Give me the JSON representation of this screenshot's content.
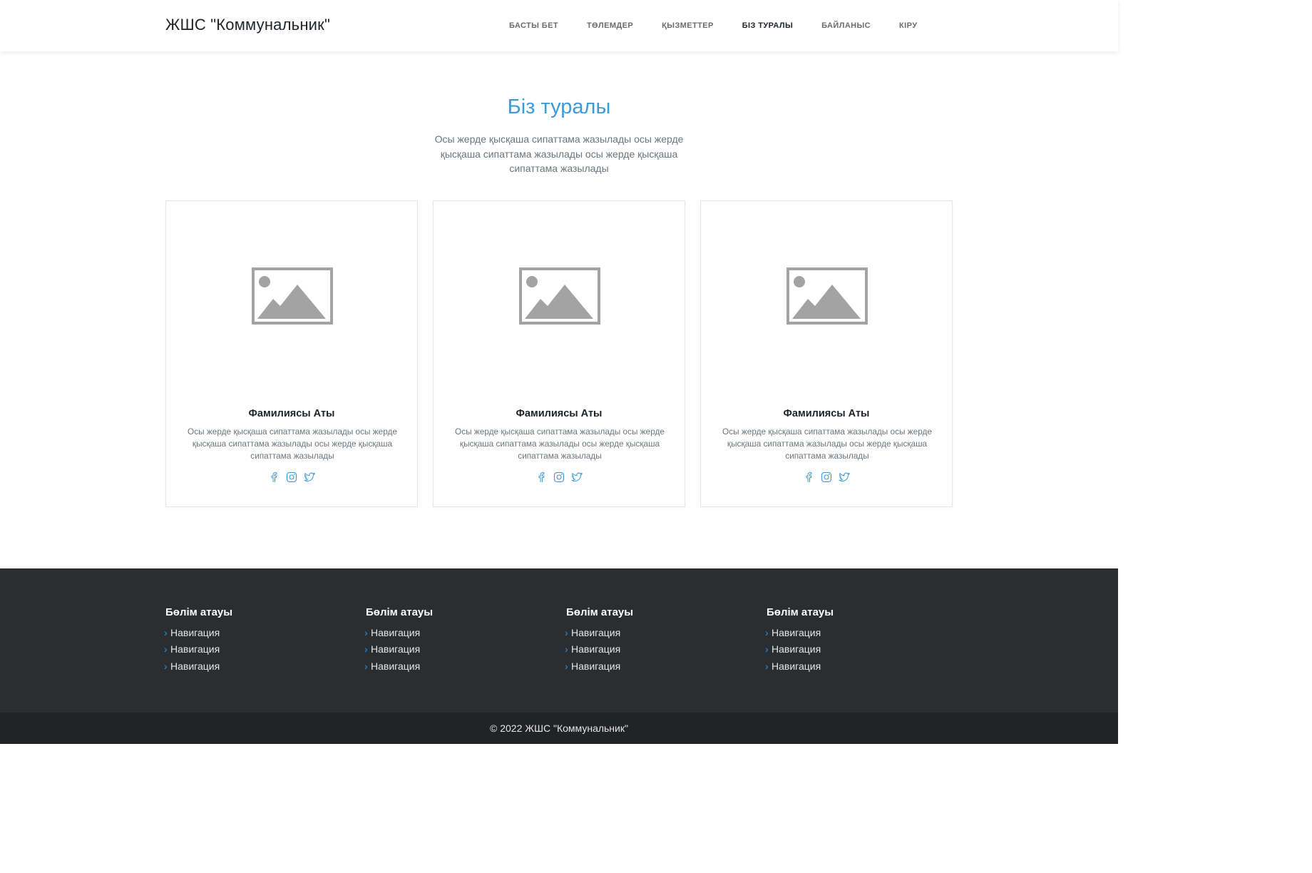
{
  "header": {
    "brand": "ЖШС \"Коммунальник\"",
    "nav": [
      "БАСТЫ БЕТ",
      "ТӨЛЕМДЕР",
      "ҚЫЗМЕТТЕР",
      "БІЗ ТУРАЛЫ",
      "БАЙЛАНЫС",
      "КІРУ"
    ],
    "active": "БІЗ ТУРАЛЫ"
  },
  "hero": {
    "title": "Біз туралы",
    "description": "Осы жерде қысқаша сипаттама жазылады осы жерде қысқаша сипаттама жазылады осы жерде қысқаша сипаттама жазылады"
  },
  "cards": [
    {
      "name": "Фамилиясы Аты",
      "description": "Осы жерде қысқаша сипаттама жазылады осы жерде қысқаша сипаттама жазылады осы жерде қысқаша сипаттама жазылады",
      "social": [
        "facebook-icon",
        "instagram-icon",
        "twitter-icon"
      ]
    },
    {
      "name": "Фамилиясы Аты",
      "description": "Осы жерде қысқаша сипаттама жазылады осы жерде қысқаша сипаттама жазылады осы жерде қысқаша сипаттама жазылады",
      "social": [
        "facebook-icon",
        "instagram-icon",
        "twitter-icon"
      ]
    },
    {
      "name": "Фамилиясы Аты",
      "description": "Осы жерде қысқаша сипаттама жазылады осы жерде қысқаша сипаттама жазылады осы жерде қысқаша сипаттама жазылады",
      "social": [
        "facebook-icon",
        "instagram-icon",
        "twitter-icon"
      ]
    }
  ],
  "footer": {
    "columns": [
      {
        "title": "Бөлім атауы",
        "links": [
          "Навигация",
          "Навигация",
          "Навигация"
        ]
      },
      {
        "title": "Бөлім атауы",
        "links": [
          "Навигация",
          "Навигация",
          "Навигация"
        ]
      },
      {
        "title": "Бөлім атауы",
        "links": [
          "Навигация",
          "Навигация",
          "Навигация"
        ]
      },
      {
        "title": "Бөлім атауы",
        "links": [
          "Навигация",
          "Навигация",
          "Навигация"
        ]
      }
    ],
    "copyright": "© 2022 ЖШС \"Коммунальник\""
  },
  "colors": {
    "accent": "#3b9bd8",
    "footer_bg": "#2b2e31",
    "copyright_bg": "#212326",
    "placeholder": "#a3a3a3"
  }
}
